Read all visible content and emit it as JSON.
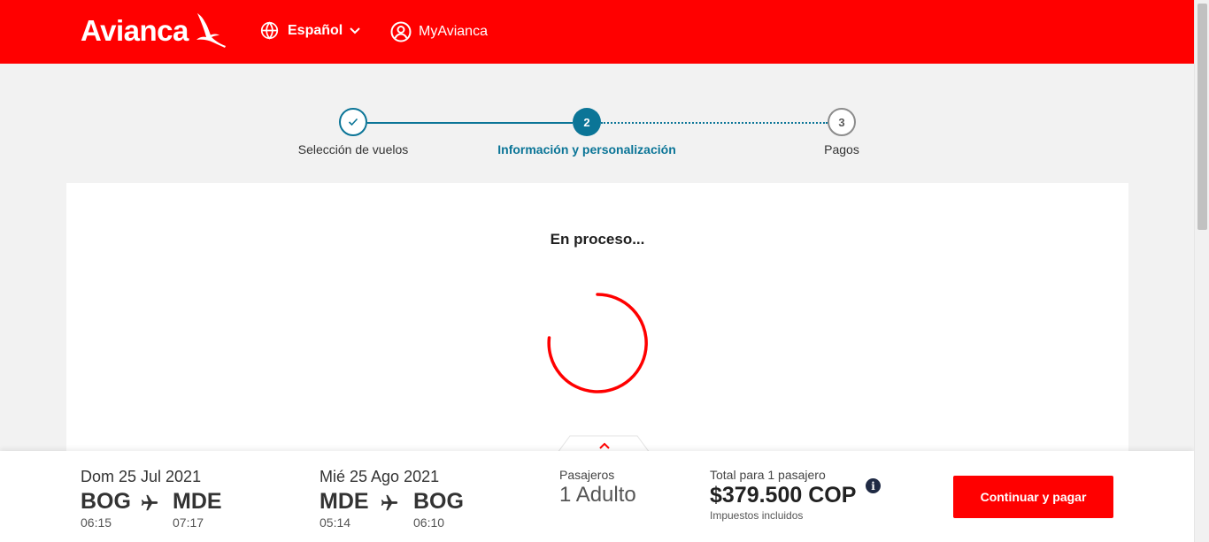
{
  "header": {
    "logo": "Avianca",
    "language": "Español",
    "account": "MyAvianca",
    "brand_color": "#ff0000"
  },
  "stepper": {
    "steps": [
      {
        "number": "1",
        "label": "Selección de vuelos",
        "status": "completed"
      },
      {
        "number": "2",
        "label": "Información y personalización",
        "status": "active"
      },
      {
        "number": "3",
        "label": "Pagos",
        "status": "pending"
      }
    ],
    "accent_color": "#0b7597"
  },
  "main": {
    "status_text": "En proceso..."
  },
  "summary": {
    "outbound": {
      "date": "Dom 25 Jul 2021",
      "origin": "BOG",
      "origin_time": "06:15",
      "destination": "MDE",
      "destination_time": "07:17"
    },
    "return": {
      "date": "Mié 25 Ago 2021",
      "origin": "MDE",
      "origin_time": "05:14",
      "destination": "BOG",
      "destination_time": "06:10"
    },
    "passengers_label": "Pasajeros",
    "passengers_value": "1 Adulto",
    "total_label": "Total para 1 pasajero",
    "total_price": "$379.500 COP",
    "taxes_label": "Impuestos incluidos",
    "cta_label": "Continuar y pagar"
  },
  "icons": {
    "language": "globe-icon",
    "language_toggle": "chevron-down-icon",
    "account": "user-circle-icon",
    "step_done": "check-icon",
    "flight": "airplane-icon",
    "info": "info-icon",
    "expand": "chevron-up-icon"
  }
}
